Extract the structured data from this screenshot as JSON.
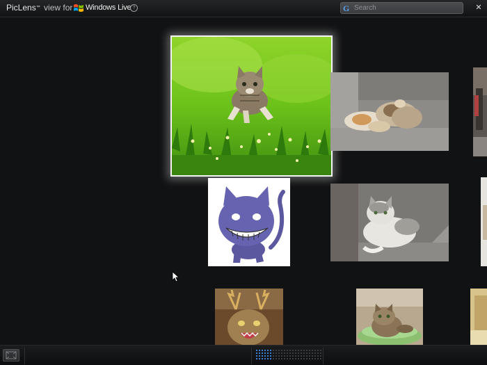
{
  "app": {
    "brand": "PicLens",
    "trademark": "™",
    "view_for": "view for",
    "partner": "Windows Live",
    "help_symbol": "?"
  },
  "search": {
    "logo_letter": "G",
    "placeholder": "Search"
  },
  "window": {
    "close_symbol": "✕"
  },
  "icons": {
    "flag": "windows-flag-icon",
    "help": "help-icon",
    "search_logo": "google-g-icon",
    "close": "close-icon",
    "fullscreen": "fullscreen-icon",
    "cursor": "mouse-pointer-icon"
  },
  "colors": {
    "background": "#111213",
    "selection_border": "#f3f3f3",
    "search_logo": "#5aa0e6",
    "active_dot": "#3e7fd9"
  },
  "pager": {
    "active_page": 1
  }
}
